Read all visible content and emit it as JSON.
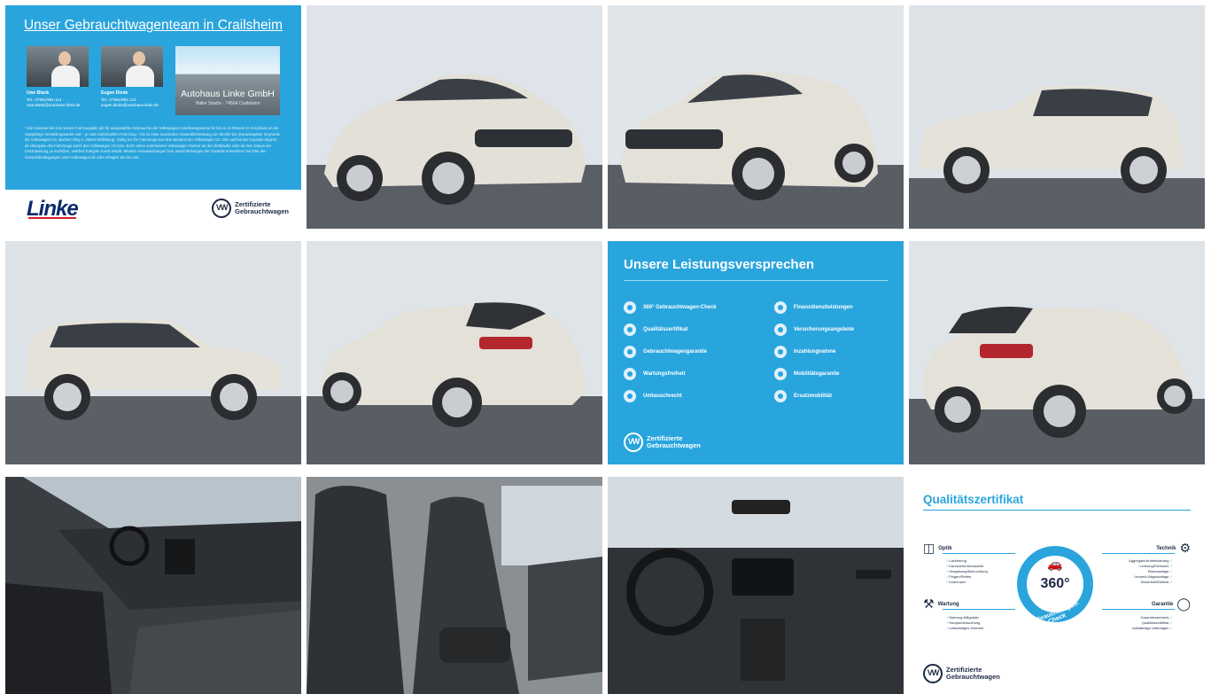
{
  "gallery": {
    "info_tile": {
      "heading": "Unser Gebrauchtwagenteam in Crailsheim",
      "person1_name": "Uwe Blank",
      "person1_contact": "Tel.: 07951/981-114 · uwe.blank@autohaus-linke.de",
      "person2_name": "Eugen Diede",
      "person2_contact": "Tel.: 07951/981-121 · eugen.diede@autohaus-linke.de",
      "building_name": "Autohaus Linke GmbH",
      "building_sub": "Haller Straße · 74564 Crailsheim",
      "fine_print": "* Die Garantie bei zum vierten Fahrzeugalter gilt für ausgewählte Gebrauchte der Volkswagen Anschlussgarantie für bis zu 24 Monate im Anschluss an die zweijährige Herstellergarantie und – je nach individuellem Fahrzeug – bis zu einer maximalen Gesamtfahrleistung von 80.000 km (Garantiegeber ist jeweils die Volkswagen AG, Berliner Ring 2, 38440 Wolfsburg). Gültig nur für Fahrzeuge aus dem Bestand der Volkswagen AG. Die Laufzeit der Garantie beginnt ab Übergabe des Fahrzeugs durch den Volkswagen AG bzw. durch einen autorisierten Volkswagen Partner an den Erstkäufer oder ab dem Datum der Erstzulassung, je nachdem, welches Ereignis zuerst eintritt. Weitere Voraussetzungen bzw. Beschränkungen der Garantie entnehmen Sie bitte den Garantiebedingungen unter volkswagen.de oder erfragen Sie bei uns.",
      "brand": "Linke",
      "badge_line1": "Zertifizierte",
      "badge_line2": "Gebrauchtwagen"
    },
    "photos": [
      {
        "id": "front-left-exterior",
        "alt": "front-left-exterior"
      },
      {
        "id": "front-right-exterior",
        "alt": "front-right-exterior"
      },
      {
        "id": "side-left-exterior",
        "alt": "side-left-exterior"
      },
      {
        "id": "side-right-exterior",
        "alt": "side-right-exterior"
      },
      {
        "id": "rear-left-exterior",
        "alt": "rear-left-exterior"
      },
      {
        "id": "rear-right-exterior",
        "alt": "rear-right-exterior"
      },
      {
        "id": "interior-dashboard-side",
        "alt": "interior-dashboard-side"
      },
      {
        "id": "interior-front-seats",
        "alt": "interior-front-seats"
      },
      {
        "id": "interior-cockpit",
        "alt": "interior-cockpit"
      }
    ],
    "promise_tile": {
      "title": "Unsere Leistungsversprechen",
      "left_items": [
        "360° Gebrauchtwagen-Check",
        "Qualitätszertifikat",
        "Gebrauchtwagengarantie",
        "Wartungsfreiheit",
        "Umtauschrecht"
      ],
      "right_items": [
        "Finanzdienstleistungen",
        "Versicherungsangebote",
        "Inzahlungnahme",
        "Mobilitätsgarantie",
        "Ersatzmobilität"
      ],
      "badge_line1": "Zertifizierte",
      "badge_line2": "Gebrauchtwagen"
    },
    "cert_tile": {
      "title": "Qualitätszertifikat",
      "center_value": "360°",
      "center_arc": "Gebrauchtwagen-Check",
      "optik_label": "Optik",
      "optik_items": [
        "Lackierung",
        "Karosserie/Anbauteile",
        "Verglasung/Beleuchtung",
        "Felgen/Reifen",
        "Innenraum"
      ],
      "technik_label": "Technik",
      "technik_items": [
        "Aggregate/Antriebsstrang",
        "Lenkung/Fahrwerk",
        "Bremsanlage",
        "Umwelt-/Abgasanlage",
        "Sicherheit/Elektrik"
      ],
      "wartung_label": "Wartung",
      "wartung_items": [
        "Wartung fällig/aktiv",
        "Hauptuntersuchung",
        "vollständiges Zubehör"
      ],
      "garantie_label": "Garantie",
      "garantie_items": [
        "Garantienachweis",
        "Qualitätszertifikat",
        "vollständige Unterlagen"
      ],
      "badge_line1": "Zertifizierte",
      "badge_line2": "Gebrauchtwagen"
    }
  }
}
